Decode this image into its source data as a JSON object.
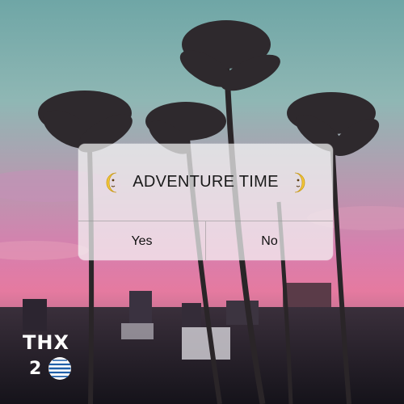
{
  "dialog": {
    "title": "ADVENTURE TIME",
    "left_icon": "last-quarter-moon-face-icon",
    "right_icon": "first-quarter-moon-face-icon",
    "buttons": {
      "yes_label": "Yes",
      "no_label": "No"
    }
  },
  "watermark": {
    "thx_text": "THX",
    "number_text": "2",
    "logo_icon": "att-globe-icon"
  }
}
